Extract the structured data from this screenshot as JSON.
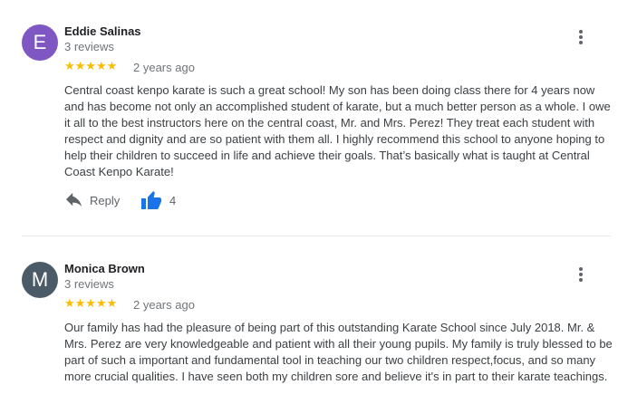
{
  "colors": {
    "star": "#fbbc04",
    "like": "#1a73e8",
    "avatar_e": "#7e57c2",
    "avatar_m": "#4a5a66"
  },
  "reviews": [
    {
      "initial": "E",
      "name": "Eddie Salinas",
      "review_count": "3 reviews",
      "stars": "★★★★★",
      "rating": 5,
      "date": "2 years ago",
      "text": "Central coast kenpo karate is such a great school! My son has been doing class there for 4 years now and has become not only an accomplished student of karate, but a much better person as a whole. I owe it all to the best instructors here on the central coast, Mr. and Mrs. Perez! They treat each student with respect and dignity and are so patient with them all. I highly recommend this school to anyone hoping to help their children to succeed in life and achieve their goals. That’s basically what is taught at Central Coast Kenpo Karate!",
      "reply_label": "Reply",
      "likes": "4"
    },
    {
      "initial": "M",
      "name": "Monica Brown",
      "review_count": "3 reviews",
      "stars": "★★★★★",
      "rating": 5,
      "date": "2 years ago",
      "text": "Our family has had the pleasure of being part of this outstanding Karate School since July 2018. Mr. & Mrs. Perez are very knowledgeable and patient with all their young pupils. My family is truly blessed to be part of such a important and fundamental tool in teaching our two children respect,focus, and so many more crucial qualities. I have seen both my children sore and believe it's in part to their karate teachings."
    }
  ]
}
